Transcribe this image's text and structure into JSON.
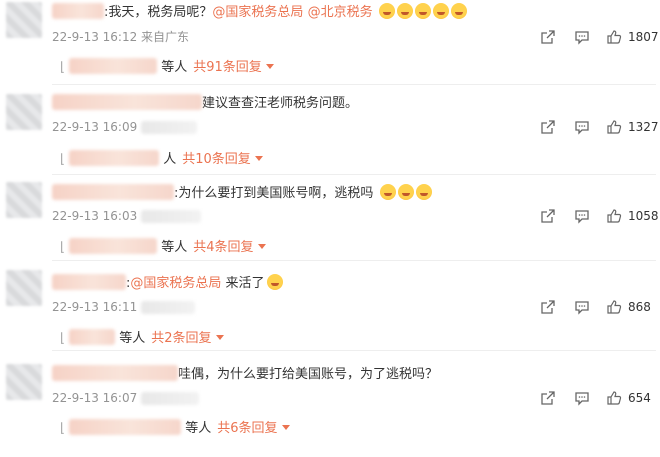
{
  "comments": [
    {
      "content_parts": [
        "我天，税务局呢？",
        "@国家税务总局",
        "@北京税务"
      ],
      "meta": "22-9-13 16:12 来自广东",
      "likes": "1807",
      "sub_prefix": "等人",
      "sub_reply": "共91条回复"
    },
    {
      "content_parts": [
        "建议查查汪老师税务问题。"
      ],
      "meta": "22-9-13 16:09",
      "likes": "1327",
      "sub_prefix": "人",
      "sub_reply": "共10条回复"
    },
    {
      "content_parts": [
        "为什么要打到美国账号啊，逃税吗"
      ],
      "meta": "22-9-13 16:03",
      "likes": "1058",
      "sub_prefix": "等人",
      "sub_reply": "共4条回复"
    },
    {
      "content_parts": [
        "@国家税务总局",
        " 来活了"
      ],
      "meta": "22-9-13 16:11",
      "likes": "868",
      "sub_prefix": "等人",
      "sub_reply": "共2条回复"
    },
    {
      "content_parts": [
        "哇偶，为什么要打给美国账号，为了逃税吗？"
      ],
      "meta": "22-9-13 16:07",
      "likes": "654",
      "sub_prefix": "等人",
      "sub_reply": "共6条回复"
    }
  ],
  "icons": {
    "share": "share-icon",
    "comment": "comment-icon",
    "like": "thumbs-up-icon"
  },
  "colors": {
    "accent": "#eb7350",
    "meta": "#939393"
  }
}
